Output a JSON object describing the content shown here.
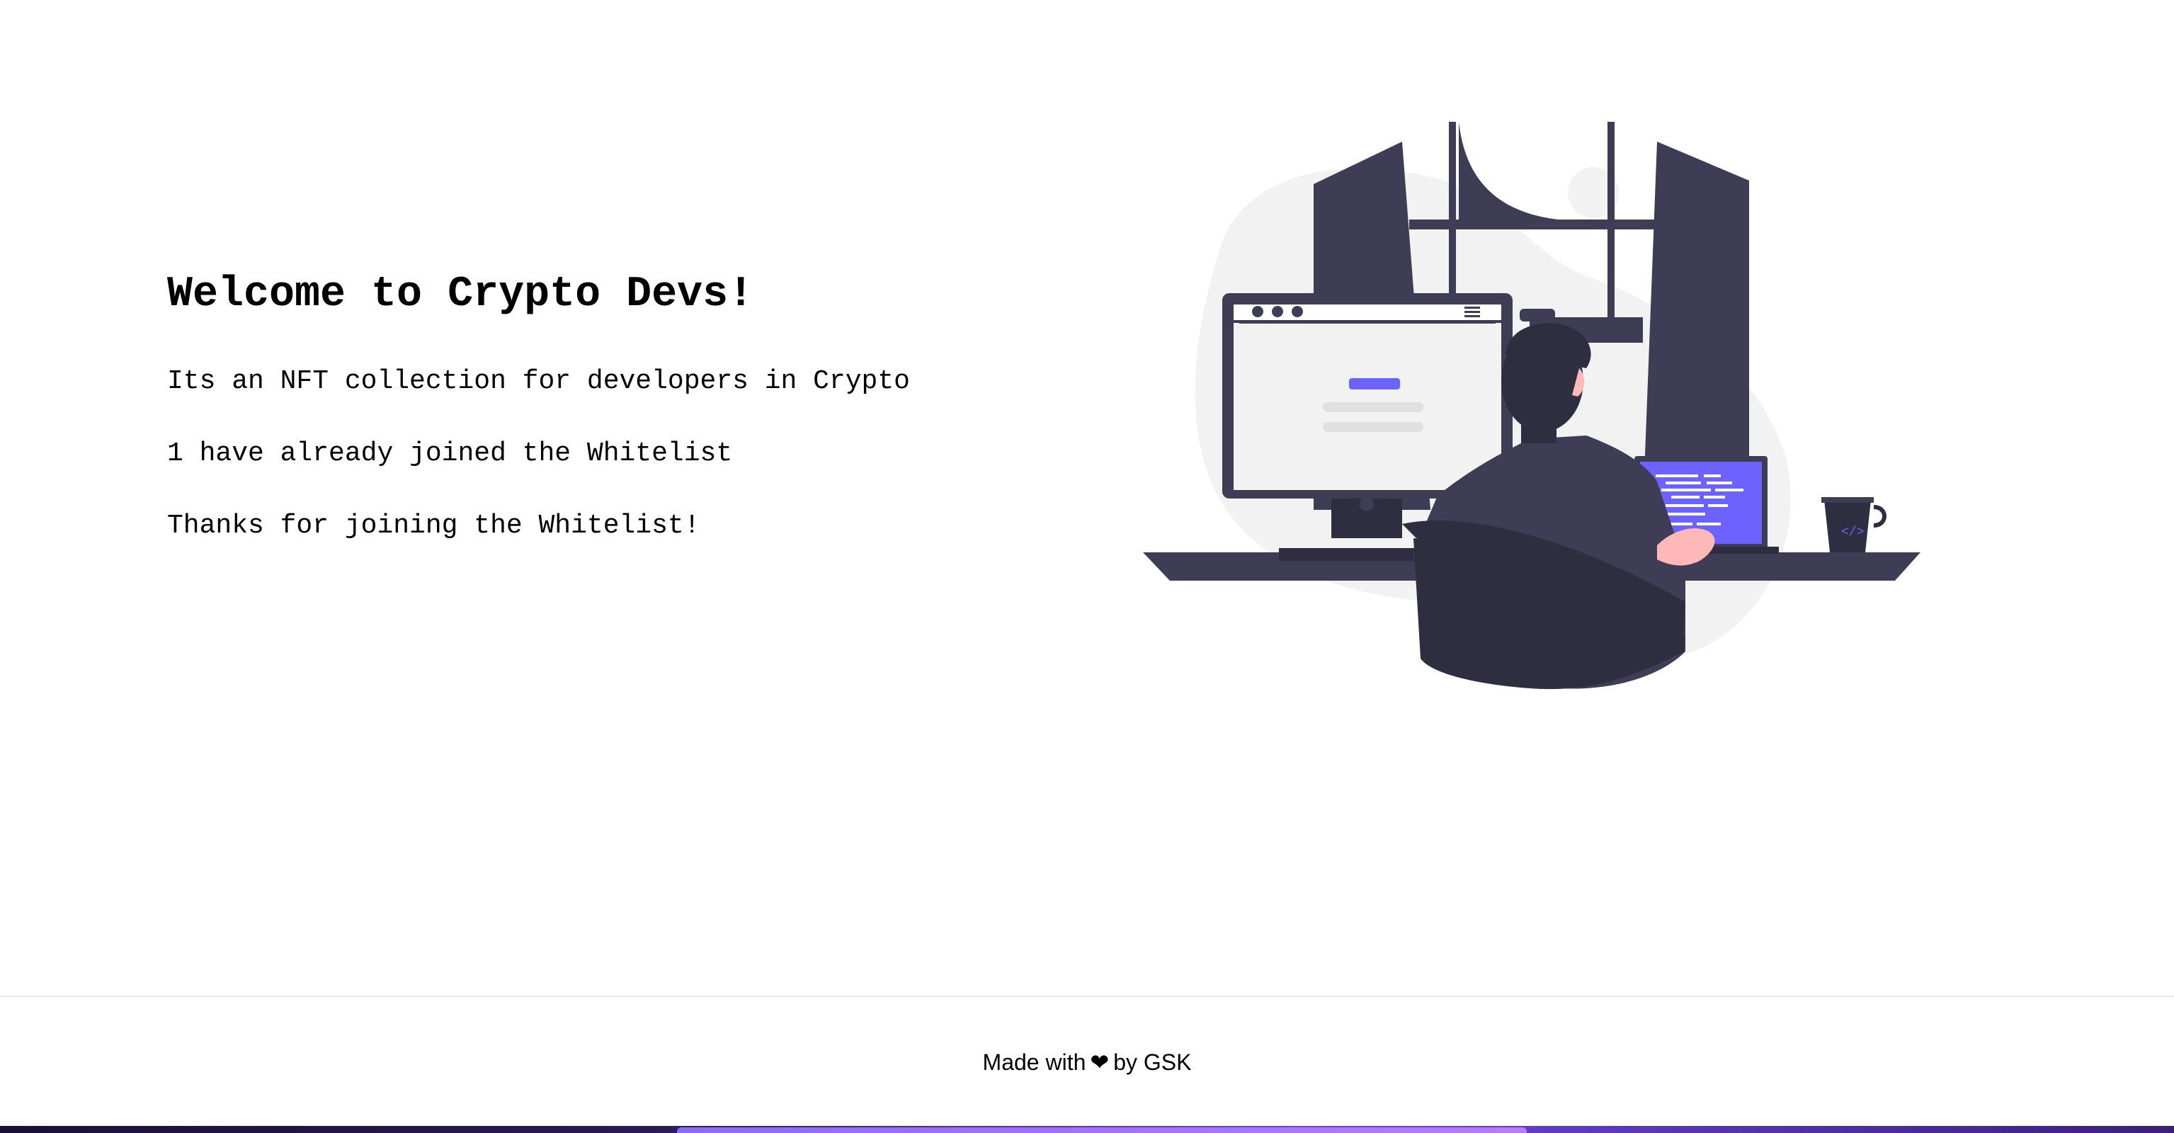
{
  "hero": {
    "title": "Welcome to Crypto Devs!",
    "description": "Its an NFT collection for developers in Crypto",
    "whitelist_count_text": "1 have already joined the Whitelist",
    "status_text": "Thanks for joining the Whitelist!"
  },
  "illustration": {
    "icon": "developer-at-desk-illustration",
    "colors": {
      "dark": "#3f3d56",
      "darker": "#2f2e41",
      "accent": "#6c63ff",
      "blob": "#f2f2f2",
      "skin": "#ffb8b8"
    }
  },
  "footer": {
    "prefix": "Made with",
    "heart": "❤",
    "suffix": "by GSK"
  }
}
